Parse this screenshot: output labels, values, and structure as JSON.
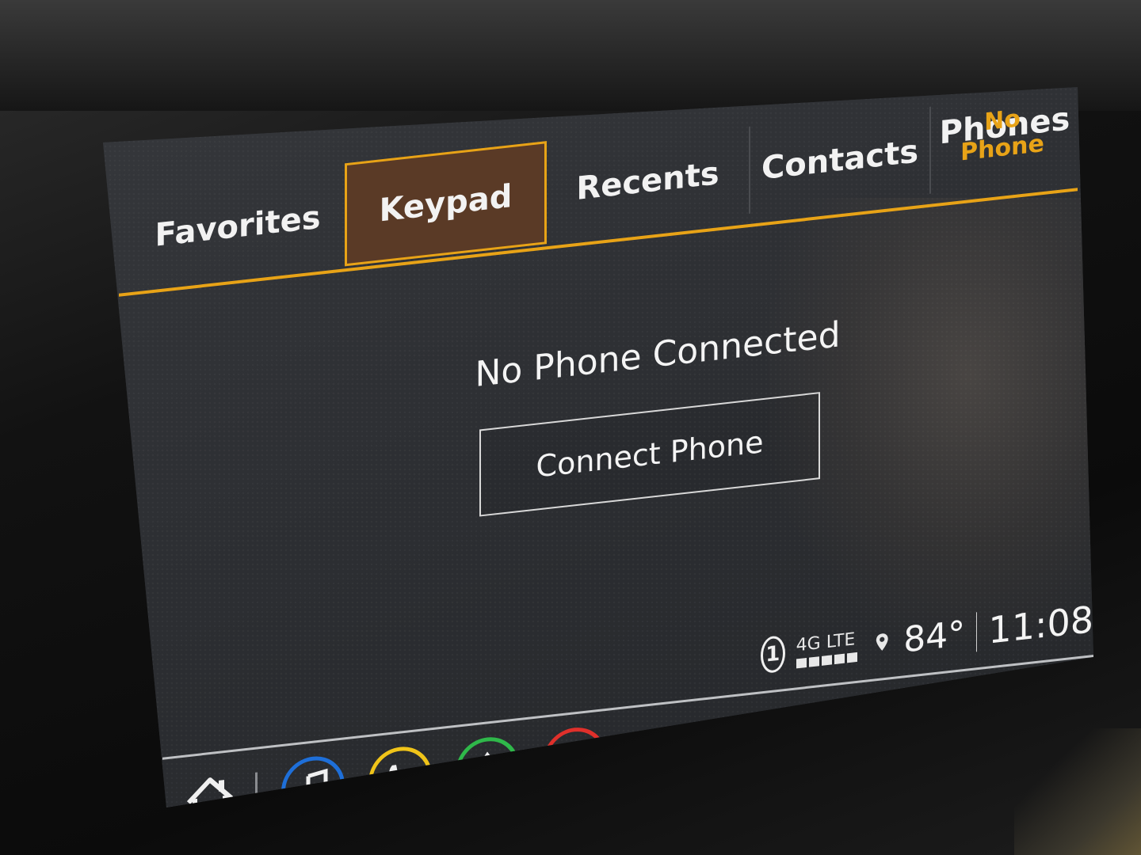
{
  "tabs": [
    {
      "label": "Favorites",
      "active": false
    },
    {
      "label": "Keypad",
      "active": true
    },
    {
      "label": "Recents",
      "active": false
    },
    {
      "label": "Contacts",
      "active": false
    },
    {
      "label": "Phones",
      "active": false
    }
  ],
  "phone_status": "No Phone",
  "main": {
    "message": "No Phone Connected",
    "connect_label": "Connect Phone"
  },
  "status_bar": {
    "user_number": "1",
    "network": "4G LTE",
    "temperature": "84°",
    "time": "11:08"
  },
  "dock": {
    "icons": [
      "home-icon",
      "music-icon",
      "phone-icon",
      "navigation-icon",
      "seat-icon"
    ],
    "colors": {
      "music": "#1e6fd9",
      "phone": "#f0c419",
      "navigation": "#2fb84a",
      "seat": "#e0302b"
    }
  },
  "colors": {
    "accent": "#e8a317",
    "active_tab_bg": "#5a3a26",
    "screen_bg": "#2e3034"
  }
}
